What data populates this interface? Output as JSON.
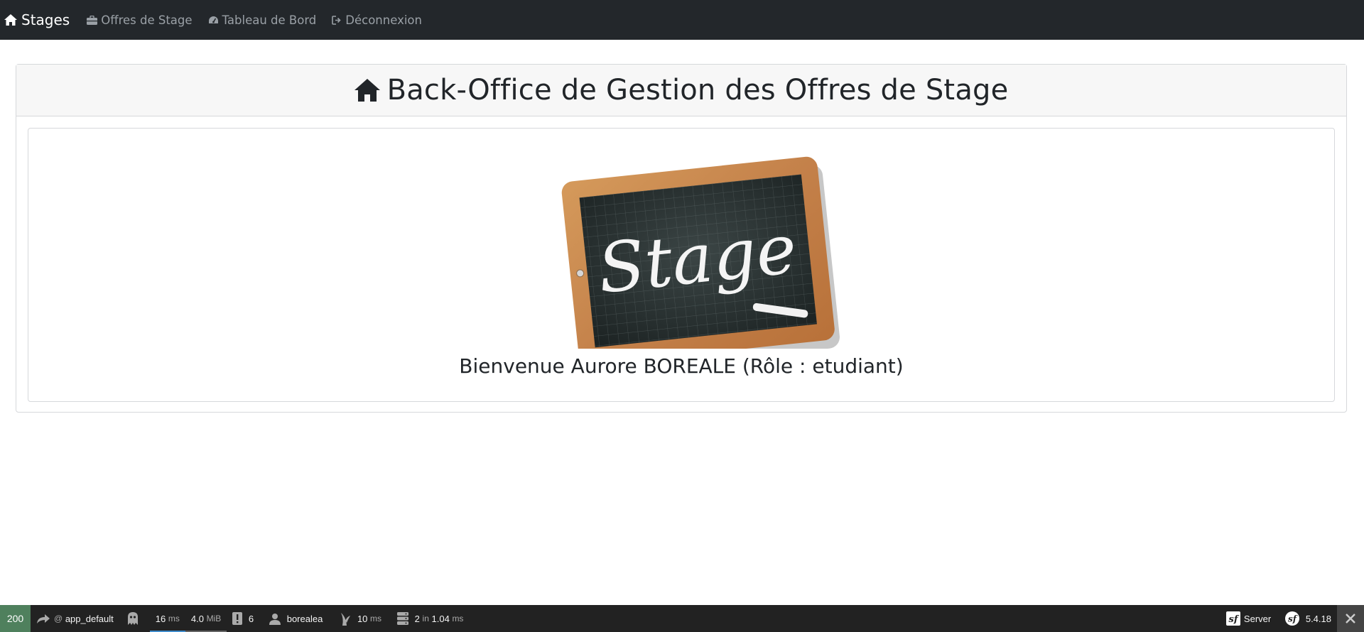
{
  "navbar": {
    "brand": "Stages",
    "items": [
      {
        "label": "Offres de Stage",
        "icon": "briefcase-icon"
      },
      {
        "label": "Tableau de Bord",
        "icon": "dashboard-icon"
      },
      {
        "label": "Déconnexion",
        "icon": "sign-out-icon"
      }
    ]
  },
  "main": {
    "title": "Back-Office de Gestion des Offres de Stage",
    "title_icon": "home-icon",
    "slate_text": "Stage",
    "welcome": "Bienvenue Aurore BOREALE (Rôle : etudiant)"
  },
  "toolbar": {
    "status_code": "200",
    "route_prefix": "@",
    "route": "app_default",
    "time_value": "16",
    "time_unit": "ms",
    "memory_value": "4.0",
    "memory_unit": "MiB",
    "logs_count": "6",
    "user": "borealea",
    "twig_value": "10",
    "twig_unit": "ms",
    "db_queries": "2",
    "db_in": "in",
    "db_time": "1.04",
    "db_unit": "ms",
    "server_label": "Server",
    "symfony_version": "5.4.18",
    "colors": {
      "status_ok": "#4f805d",
      "background": "#222222"
    }
  }
}
